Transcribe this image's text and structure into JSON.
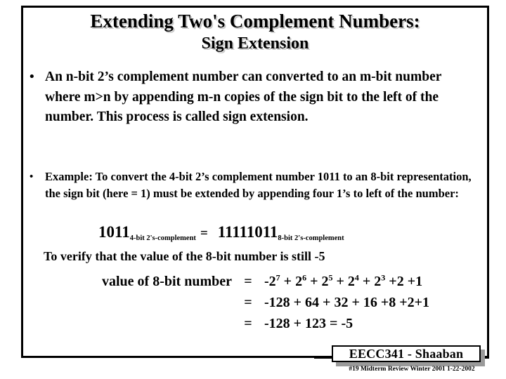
{
  "slide": {
    "title_line1": "Extending Two's Complement Numbers:",
    "title_line2": "Sign Extension",
    "bullet_marker": "•",
    "bullets": [
      {
        "text": "An n-bit 2’s complement number can converted to an m-bit number where  m>n  by appending  m-n  copies of the sign bit to the left of the number.  This process is called sign extension."
      },
      {
        "text": "Example:  To convert  the  4-bit 2’s complement number 1011 to an  8-bit representation, the sign bit (here = 1)  must be extended  by appending four  1’s to left of the number:"
      }
    ],
    "equation_binary": {
      "left_value": "1011",
      "left_subscript": "4-bit 2's-complement",
      "equals": "=",
      "right_value": "11111011",
      "right_subscript": "8-bit 2's-complement"
    },
    "verify_line": "To verify that the value of the 8-bit number is still -5",
    "calculation": [
      {
        "lhs": "value of 8-bit number",
        "eq": "=",
        "rhs_parts": [
          {
            "text": "-2",
            "sup": "7"
          },
          {
            "text": "  +  2",
            "sup": "6"
          },
          {
            "text": " + 2",
            "sup": "5"
          },
          {
            "text": " + 2",
            "sup": "4"
          },
          {
            "text": " + 2",
            "sup": "3"
          },
          {
            "text": " +2 +1",
            "sup": ""
          }
        ]
      },
      {
        "lhs": "",
        "eq": "=",
        "rhs_parts": [
          {
            "text": "-128  +  64 + 32 + 16 +8 +2+1",
            "sup": ""
          }
        ]
      },
      {
        "lhs": "",
        "eq": "=",
        "rhs_parts": [
          {
            "text": "-128  +  123  =  -5",
            "sup": ""
          }
        ]
      }
    ],
    "footer": {
      "badge_label": "EECC341 - Shaaban",
      "fine_print": "#19   Midterm Review   Winter 2001   1-22-2002"
    },
    "colors": {
      "text": "#000000",
      "background": "#ffffff",
      "title_shadow": "#c9c9c9",
      "badge_shadow": "#9a9a9a"
    }
  }
}
